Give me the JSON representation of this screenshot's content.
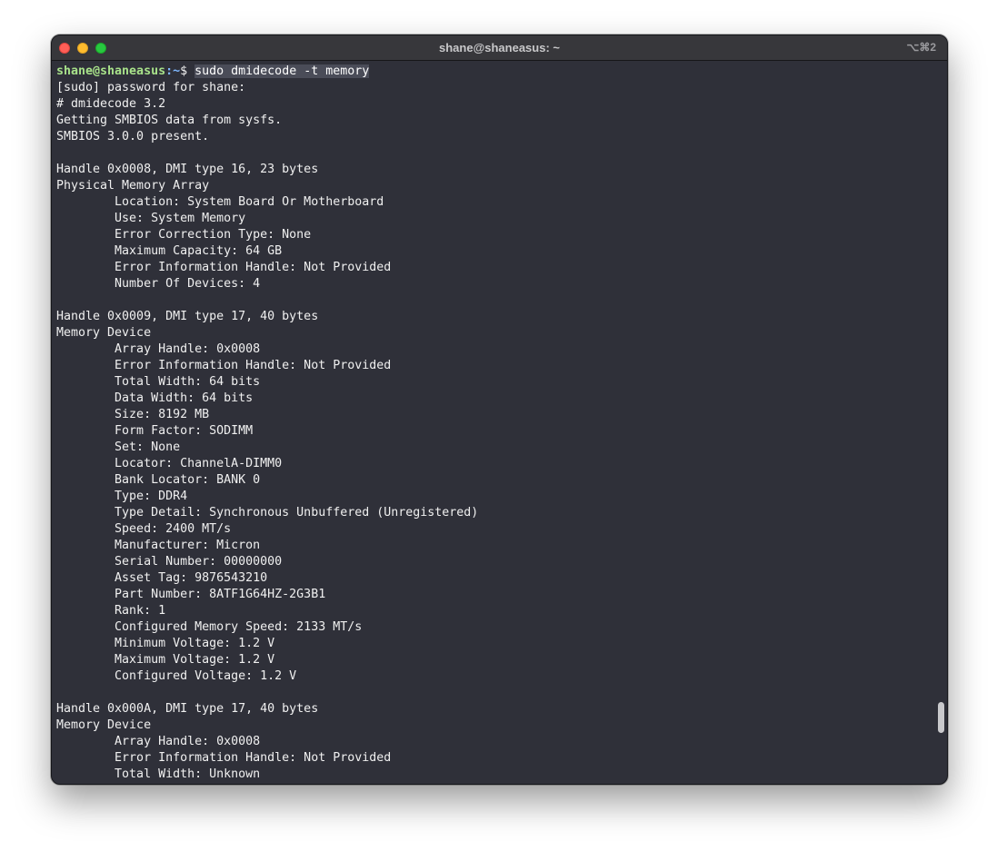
{
  "window": {
    "title": "shane@shaneasus: ~",
    "shortcut": "⌥⌘2"
  },
  "prompt": {
    "user_host": "shane@shaneasus",
    "path": ":~",
    "symbol": "$ ",
    "command": "sudo dmidecode -t memory"
  },
  "output": [
    "[sudo] password for shane:",
    "# dmidecode 3.2",
    "Getting SMBIOS data from sysfs.",
    "SMBIOS 3.0.0 present.",
    "",
    "Handle 0x0008, DMI type 16, 23 bytes",
    "Physical Memory Array",
    "        Location: System Board Or Motherboard",
    "        Use: System Memory",
    "        Error Correction Type: None",
    "        Maximum Capacity: 64 GB",
    "        Error Information Handle: Not Provided",
    "        Number Of Devices: 4",
    "",
    "Handle 0x0009, DMI type 17, 40 bytes",
    "Memory Device",
    "        Array Handle: 0x0008",
    "        Error Information Handle: Not Provided",
    "        Total Width: 64 bits",
    "        Data Width: 64 bits",
    "        Size: 8192 MB",
    "        Form Factor: SODIMM",
    "        Set: None",
    "        Locator: ChannelA-DIMM0",
    "        Bank Locator: BANK 0",
    "        Type: DDR4",
    "        Type Detail: Synchronous Unbuffered (Unregistered)",
    "        Speed: 2400 MT/s",
    "        Manufacturer: Micron",
    "        Serial Number: 00000000",
    "        Asset Tag: 9876543210",
    "        Part Number: 8ATF1G64HZ-2G3B1",
    "        Rank: 1",
    "        Configured Memory Speed: 2133 MT/s",
    "        Minimum Voltage: 1.2 V",
    "        Maximum Voltage: 1.2 V",
    "        Configured Voltage: 1.2 V",
    "",
    "Handle 0x000A, DMI type 17, 40 bytes",
    "Memory Device",
    "        Array Handle: 0x0008",
    "        Error Information Handle: Not Provided",
    "        Total Width: Unknown"
  ]
}
